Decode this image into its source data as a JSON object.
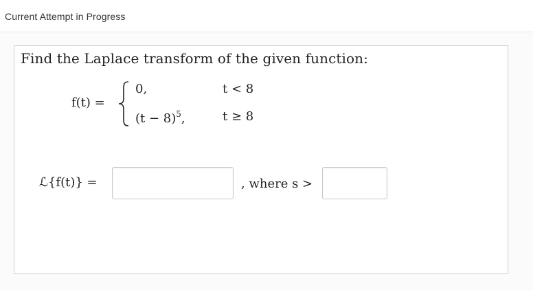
{
  "header": {
    "title": "Current Attempt in Progress"
  },
  "question": {
    "prompt": "Find the Laplace transform of the given function:",
    "function_label": "f(t) =",
    "cases": [
      {
        "expression": "0,",
        "condition": "t < 8"
      },
      {
        "expression_base": "(t − 8)",
        "expression_exponent": "5",
        "expression_suffix": ",",
        "condition": "t ≥ 8"
      }
    ],
    "laplace_label": "ℒ{f(t)} =",
    "where_label": ", where s >"
  },
  "inputs": {
    "laplace_answer": {
      "value": ""
    },
    "s_bound_answer": {
      "value": ""
    }
  }
}
